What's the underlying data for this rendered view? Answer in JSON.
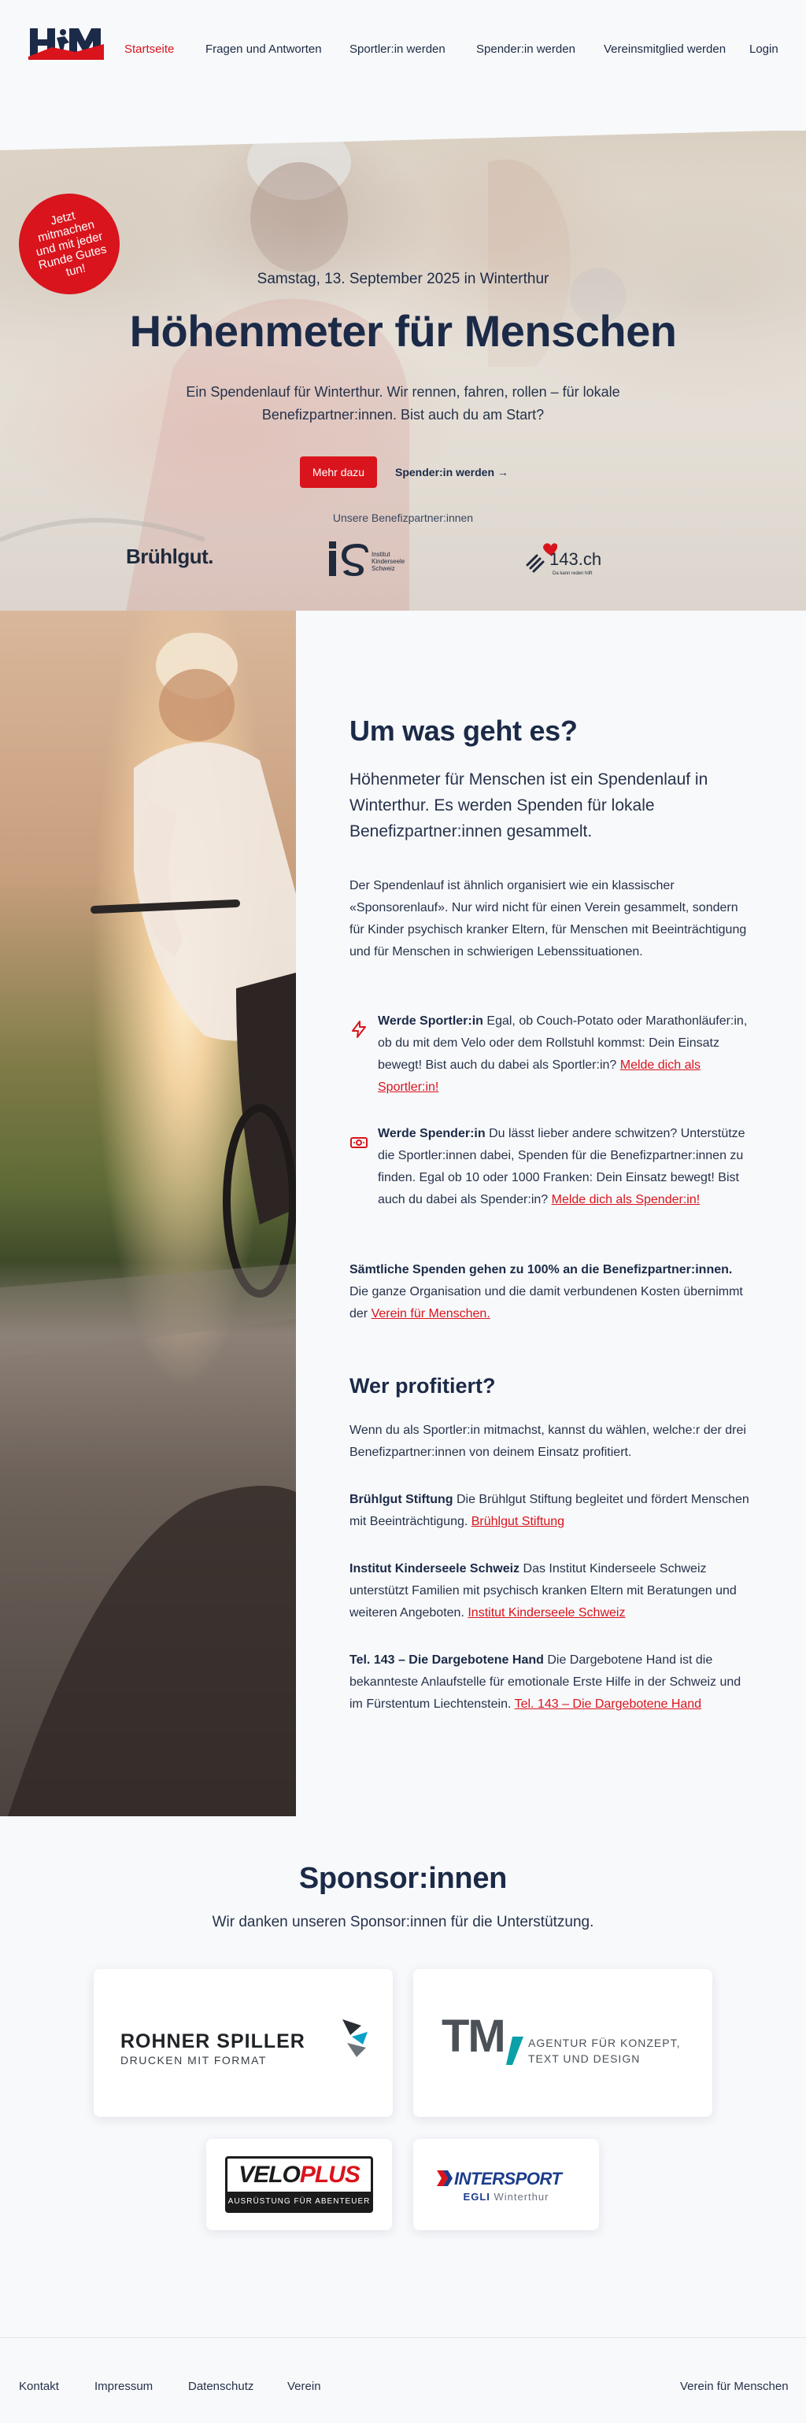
{
  "nav": {
    "logo_alt": "HfM",
    "links": [
      {
        "label": "Startseite",
        "active": true
      },
      {
        "label": "Fragen und Antworten",
        "active": false
      },
      {
        "label": "Sportler:in werden",
        "active": false
      },
      {
        "label": "Spender:in werden",
        "active": false
      },
      {
        "label": "Vereinsmitglied werden",
        "active": false
      },
      {
        "label": "Login",
        "active": false
      }
    ]
  },
  "hero": {
    "badge": "Jetzt mitmachen und mit jeder Runde Gutes tun!",
    "date": "Samstag, 13. September 2025 in Winterthur",
    "title": "Höhenmeter für Menschen",
    "subtitle": "Ein Spendenlauf für Winterthur. Wir rennen, fahren, rollen – für lokale Benefizpartner:innen. Bist auch du am Start?",
    "primary_button": "Mehr dazu",
    "secondary_link": "Spender:in werden →",
    "partners_label": "Unsere Benefizpartner:innen",
    "partners": {
      "bruehlgut": "Brühlgut.",
      "ks_text": "Institut Kinderseele Schweiz",
      "dh_number": "143.ch",
      "dh_sub": "Da kann reden hilft"
    }
  },
  "about": {
    "title": "Um was geht es?",
    "lead": "Höhenmeter für Menschen ist ein Spendenlauf in Winterthur. Es werden Spenden für lokale Benefizpartner:innen gesammelt.",
    "intro": "Der Spendenlauf ist ähnlich organisiert wie ein klassischer «Sponsorenlauf». Nur wird nicht für einen Verein gesammelt, sondern für Kinder psychisch kranker Eltern, für Menschen mit Beeinträchtigung und für Menschen in schwierigen Lebenssituationen.",
    "feature_athlete": {
      "title": "Werde Sportler:in",
      "text": " Egal, ob Couch-Potato oder Marathonläufer:in, ob du mit dem Velo oder dem Rollstuhl kommst: Dein Einsatz bewegt! Bist auch du dabei als Sportler:in? ",
      "link": "Melde dich als Sportler:in!"
    },
    "feature_donor": {
      "title": "Werde Spender:in",
      "text": " Du lässt lieber andere schwitzen? Unterstütze die Sportler:innen dabei, Spenden für die Benefizpartner:innen zu finden. Egal ob 10 oder 1000 Franken: Dein Einsatz bewegt! Bist auch du dabei als Spender:in? ",
      "link": "Melde dich als Spender:in!"
    },
    "all_donations": {
      "title": "Sämtliche Spenden gehen zu 100% an die Benefizpartner:innen.",
      "text": " Die ganze Organisation und die damit verbundenen Kosten übernimmt der ",
      "link": "Verein für Menschen."
    }
  },
  "profit": {
    "title": "Wer profitiert?",
    "intro": "Wenn du als Sportler:in mitmachst, kannst du wählen, welche:r der drei Benefizpartner:innen von deinem Einsatz profitiert.",
    "partners": [
      {
        "name": "Brühlgut Stiftung",
        "text": " Die Brühlgut Stiftung begleitet und fördert Menschen mit Beeinträchtigung. ",
        "link": "Brühlgut Stiftung"
      },
      {
        "name": "Institut Kinderseele Schweiz",
        "text": " Das Institut Kinderseele Schweiz unterstützt Familien mit psychisch kranken Eltern mit Beratungen und weiteren Angeboten. ",
        "link": "Institut Kinderseele Schweiz"
      },
      {
        "name": "Tel. 143 – Die Dargebotene Hand",
        "text": " Die Dargebotene Hand ist die bekannteste Anlaufstelle für emotionale Erste Hilfe in der Schweiz und im Fürstentum Liechtenstein. ",
        "link": "Tel. 143 – Die Dargebotene Hand"
      }
    ]
  },
  "sponsors": {
    "title": "Sponsor:innen",
    "subtitle": "Wir danken unseren Sponsor:innen für die Unterstützung.",
    "rohner_main": "ROHNER SPILLER",
    "rohner_sub": "DRUCKEN MIT FORMAT",
    "tm_mark": "TM",
    "tm_line1": "AGENTUR FÜR KONZEPT,",
    "tm_line2": "TEXT UND DESIGN",
    "velo_main": "VELO",
    "velo_plus": "PLUS",
    "velo_sub": "AUSRÜSTUNG FÜR ABENTEUER",
    "inter_main": "INTERSPORT",
    "inter_sub1": "EGLI",
    "inter_sub2": " Winterthur"
  },
  "footer": {
    "links": [
      "Kontakt",
      "Impressum",
      "Datenschutz",
      "Verein"
    ],
    "right": "Verein für Menschen"
  },
  "colors": {
    "accent": "#d9141c",
    "navy": "#1b2a47",
    "page_bg": "#f8f9fb"
  }
}
